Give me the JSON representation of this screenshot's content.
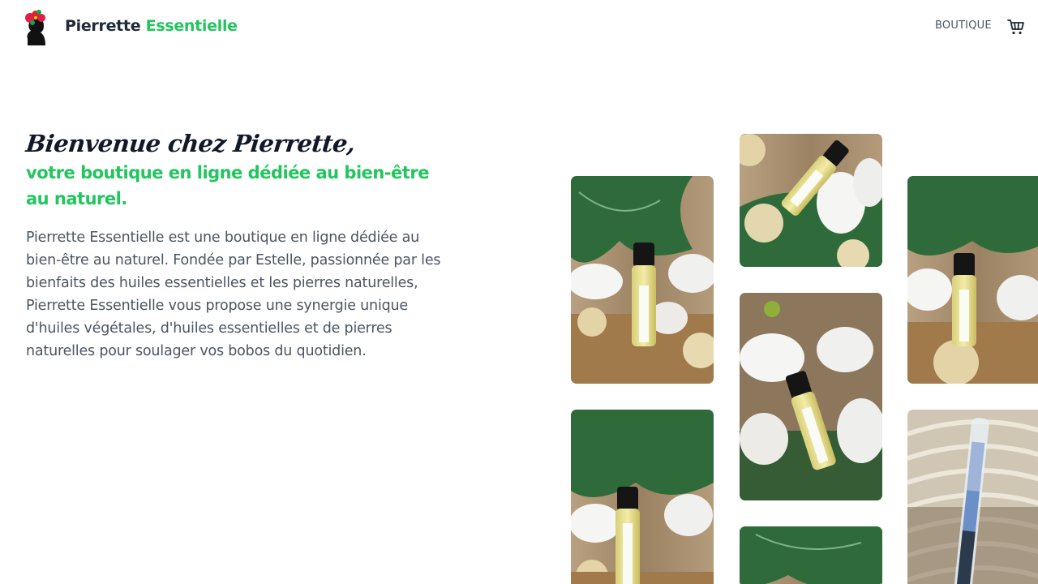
{
  "header": {
    "brand_part1": "Pierrette",
    "brand_part2": "Essentielle",
    "nav_boutique": "BOUTIQUE",
    "logo_icon": "woman-silhouette-flower-logo",
    "cart_icon": "cart-icon"
  },
  "hero": {
    "welcome": "Bienvenue chez Pierrette,",
    "tagline": "votre boutique en ligne dédiée au bien-être au naturel.",
    "description": "Pierrette Essentielle est une boutique en ligne dédiée au bien-être au naturel. Fondée par Estelle, passionnée par les bienfaits des huiles essentielles et les pierres naturelles, Pierrette Essentielle vous propose une synergie unique d'huiles végétales, d'huiles essentielles et de pierres naturelles pour soulager vos bobos du quotidien."
  },
  "gallery": {
    "images": [
      {
        "name": "roll-on-bottle-photo-1"
      },
      {
        "name": "roll-on-bottle-photo-2"
      },
      {
        "name": "roll-on-bottle-photo-3"
      },
      {
        "name": "roll-on-bottle-photo-4"
      },
      {
        "name": "roll-on-bottle-photo-5"
      },
      {
        "name": "roll-on-bottle-photo-6"
      },
      {
        "name": "stone-vial-photo"
      }
    ]
  },
  "colors": {
    "accent": "#22c55e",
    "text_dark": "#1f2937",
    "text_body": "#4b5563"
  }
}
